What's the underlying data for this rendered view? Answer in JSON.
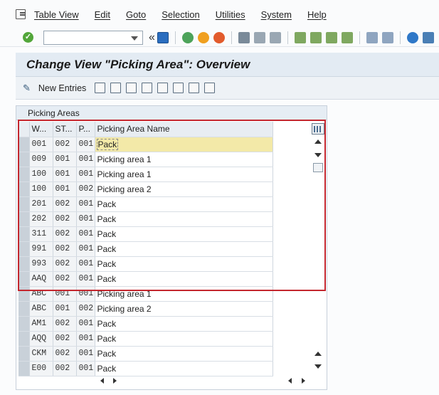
{
  "menu": {
    "items": [
      "Table View",
      "Edit",
      "Goto",
      "Selection",
      "Utilities",
      "System",
      "Help"
    ]
  },
  "toolbar": {
    "command_value": ""
  },
  "title": "Change View \"Picking Area\": Overview",
  "app_toolbar": {
    "new_entries_label": "New Entries"
  },
  "table": {
    "caption": "Picking Areas",
    "headers": [
      "W...",
      "ST...",
      "P...",
      "Picking Area Name"
    ],
    "rows": [
      [
        "001",
        "002",
        "001",
        "Pack"
      ],
      [
        "009",
        "001",
        "001",
        "Picking area 1"
      ],
      [
        "100",
        "001",
        "001",
        "Picking area 1"
      ],
      [
        "100",
        "001",
        "002",
        "Picking area 2"
      ],
      [
        "201",
        "002",
        "001",
        "Pack"
      ],
      [
        "202",
        "002",
        "001",
        "Pack"
      ],
      [
        "311",
        "002",
        "001",
        "Pack"
      ],
      [
        "991",
        "002",
        "001",
        "Pack"
      ],
      [
        "993",
        "002",
        "001",
        "Pack"
      ],
      [
        "AAQ",
        "002",
        "001",
        "Pack"
      ],
      [
        "ABC",
        "001",
        "001",
        "Picking area 1"
      ],
      [
        "ABC",
        "001",
        "002",
        "Picking area 2"
      ],
      [
        "AM1",
        "002",
        "001",
        "Pack"
      ],
      [
        "AQQ",
        "002",
        "001",
        "Pack"
      ],
      [
        "CKM",
        "002",
        "001",
        "Pack"
      ],
      [
        "E00",
        "002",
        "001",
        "Pack"
      ]
    ]
  },
  "colors": {
    "highlight_box": "#c4272f",
    "selected_row": "#f3e9a8",
    "title_bar_bg": "#e3ebf3"
  }
}
